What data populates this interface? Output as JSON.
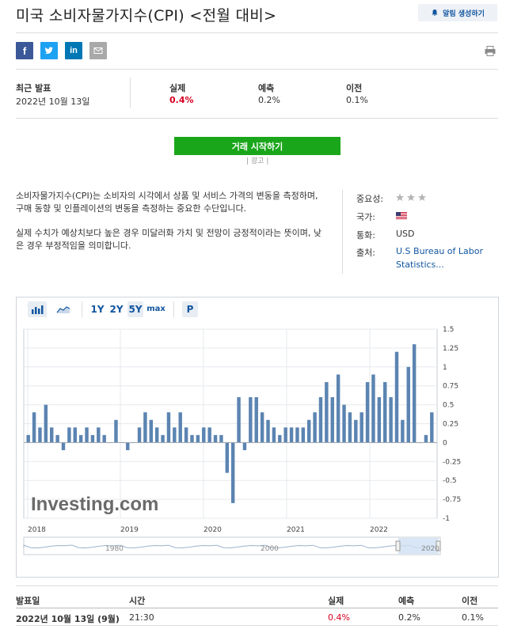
{
  "header": {
    "title": "미국 소비자물가지수(CPI) <전월 대비>",
    "alert_label": "알림 생성하기"
  },
  "share": [
    {
      "name": "facebook",
      "color": "#3b5998",
      "glyph": "f"
    },
    {
      "name": "twitter",
      "color": "#1da1f2",
      "glyph": "t"
    },
    {
      "name": "linkedin",
      "color": "#0077b5",
      "glyph": "in"
    },
    {
      "name": "email",
      "color": "#999999",
      "glyph": "mail"
    }
  ],
  "stats": {
    "latest_label": "최근 발표",
    "latest_date": "2022년 10월 13일",
    "actual_label": "실제",
    "actual_value": "0.4%",
    "forecast_label": "예측",
    "forecast_value": "0.2%",
    "previous_label": "이전",
    "previous_value": "0.1%"
  },
  "trade_button": "거래 시작하기",
  "ad_label": "| 광고 |",
  "description": {
    "p1": "소비자물가지수(CPI)는 소비자의 시각에서 상품 및 서비스 가격의 변동을 측정하며, 구매 동향 및 인플레이션의 변동을 측정하는 중요한 수단입니다.",
    "p2": "실제 수치가 예상치보다 높은 경우 미달러화 가치 및 전망이 긍정적이라는 뜻이며, 낮은 경우 부정적임을 의미합니다."
  },
  "side": {
    "importance_label": "중요성:",
    "country_label": "국가:",
    "currency_label": "통화:",
    "currency_value": "USD",
    "source_label": "출처:",
    "source_value": "U.S Bureau of Labor Statistics..."
  },
  "toolbar": {
    "range_1y": "1Y",
    "range_2y": "2Y",
    "range_5y": "5Y",
    "range_max": "max",
    "p_button": "P"
  },
  "chart_data": {
    "type": "bar",
    "y_ticks": [
      "1.5",
      "1.25",
      "1",
      "0.75",
      "0.5",
      "0.25",
      "0",
      "-0.25",
      "-0.5",
      "-0.75",
      "-1"
    ],
    "ylim": [
      -1,
      1.5
    ],
    "x_ticks": [
      "2018",
      "2019",
      "2020",
      "2021",
      "2022"
    ],
    "navigator_ticks": [
      "1980",
      "2000",
      "2020"
    ],
    "watermark": "Investing.com",
    "values": [
      0.1,
      0.4,
      0.2,
      0.5,
      0.2,
      0.1,
      -0.1,
      0.2,
      0.2,
      0.1,
      0.2,
      0.1,
      0.2,
      0.1,
      0.0,
      0.3,
      0.0,
      -0.1,
      0.0,
      0.2,
      0.4,
      0.3,
      0.2,
      0.1,
      0.4,
      0.2,
      0.4,
      0.2,
      0.1,
      0.1,
      0.2,
      0.2,
      0.1,
      0.1,
      -0.4,
      -0.8,
      0.6,
      -0.1,
      0.6,
      0.6,
      0.4,
      0.3,
      0.2,
      0.1,
      0.2,
      0.2,
      0.2,
      0.2,
      0.3,
      0.4,
      0.6,
      0.8,
      0.6,
      0.9,
      0.5,
      0.4,
      0.3,
      0.4,
      0.8,
      0.9,
      0.6,
      0.8,
      0.6,
      1.2,
      0.3,
      1.0,
      1.3,
      0.0,
      0.1,
      0.4
    ],
    "bar_color": "#5b84b1"
  },
  "table": {
    "headers": {
      "date": "발표일",
      "time": "시간",
      "actual": "실제",
      "forecast": "예측",
      "previous": "이전"
    },
    "row": {
      "date": "2022년 10월 13일 (9월)",
      "time": "21:30",
      "actual": "0.4%",
      "forecast": "0.2%",
      "previous": "0.1%"
    }
  }
}
